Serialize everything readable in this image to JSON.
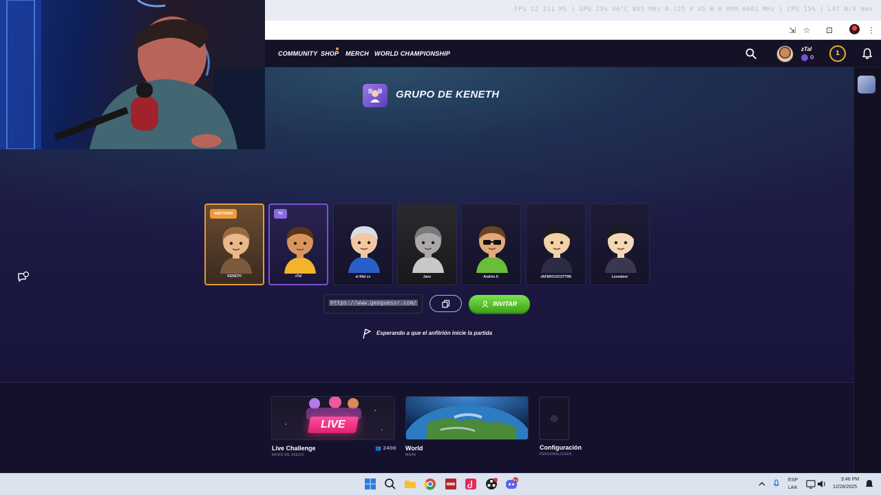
{
  "browser": {
    "overlay_stats": "FPS 12 211 MS | GPU 25% 46°C 885 MHz 0.725 V 45 W 0 RPM 6001 MHz | CPU 15% | LAT N/A 0ms"
  },
  "nav": {
    "links": [
      "COMMUNITY",
      "SHOP",
      "MERCH",
      "WORLD CHAMPIONSHIP"
    ],
    "username": "zTal",
    "coins": "0",
    "level": "1"
  },
  "party": {
    "title": "GRUPO DE KENETH",
    "players": [
      {
        "name": "KENETH",
        "tag": "ANFITRIÓN",
        "role": "host",
        "skin": "#e8b98a",
        "hair": "#9b6a3c",
        "shirt": "#7a5a3a"
      },
      {
        "name": "zTal",
        "tag": "TÚ",
        "role": "me",
        "skin": "#d8955f",
        "hair": "#5a3418",
        "shirt": "#f2b52a"
      },
      {
        "name": "el Riki cv",
        "tag": "",
        "role": "",
        "skin": "#f0c8a4",
        "hair": "#d9dde6",
        "shirt": "#2a5ec8"
      },
      {
        "name": "Janx",
        "tag": "",
        "role": "gray",
        "skin": "#a9a9a9",
        "hair": "#7a7a7a",
        "shirt": "#c8c8c8"
      },
      {
        "name": "Andrés F.",
        "tag": "",
        "role": "",
        "skin": "#e2a97a",
        "hair": "#6a4324",
        "shirt": "#6abd3a"
      },
      {
        "name": "JAFERCUCCITTINI",
        "tag": "",
        "role": "",
        "skin": "#f2d2a6",
        "hair": "#1c1c22",
        "shirt": "#2c2c44"
      },
      {
        "name": "Leonalser",
        "tag": "",
        "role": "",
        "skin": "#f3d8b8",
        "hair": "#1a1a20",
        "shirt": "#3a3750"
      }
    ],
    "invite_url": "https://www.geoguessr.com/",
    "invite_label": "INVITAR",
    "waiting_text": "Esperando a que el anfitrión inicie la partida"
  },
  "modes": {
    "live": {
      "badge": "LIVE",
      "title": "Live Challenge",
      "subtitle": "MODO DE JUEGO",
      "players": "2400"
    },
    "world": {
      "title": "World",
      "subtitle": "MAPA"
    },
    "config": {
      "title": "Configuración",
      "subtitle": "PERSONALIZADA"
    }
  },
  "taskbar": {
    "lang1": "ESP",
    "lang2": "LAA",
    "time": "9:48 PM",
    "date": "12/26/2025",
    "discord_badge": "9+"
  },
  "colors": {
    "accent_green": "#4fc02a",
    "host_orange": "#e69a3c",
    "me_purple": "#7a53d8",
    "live_pink": "#ff4fa0"
  }
}
